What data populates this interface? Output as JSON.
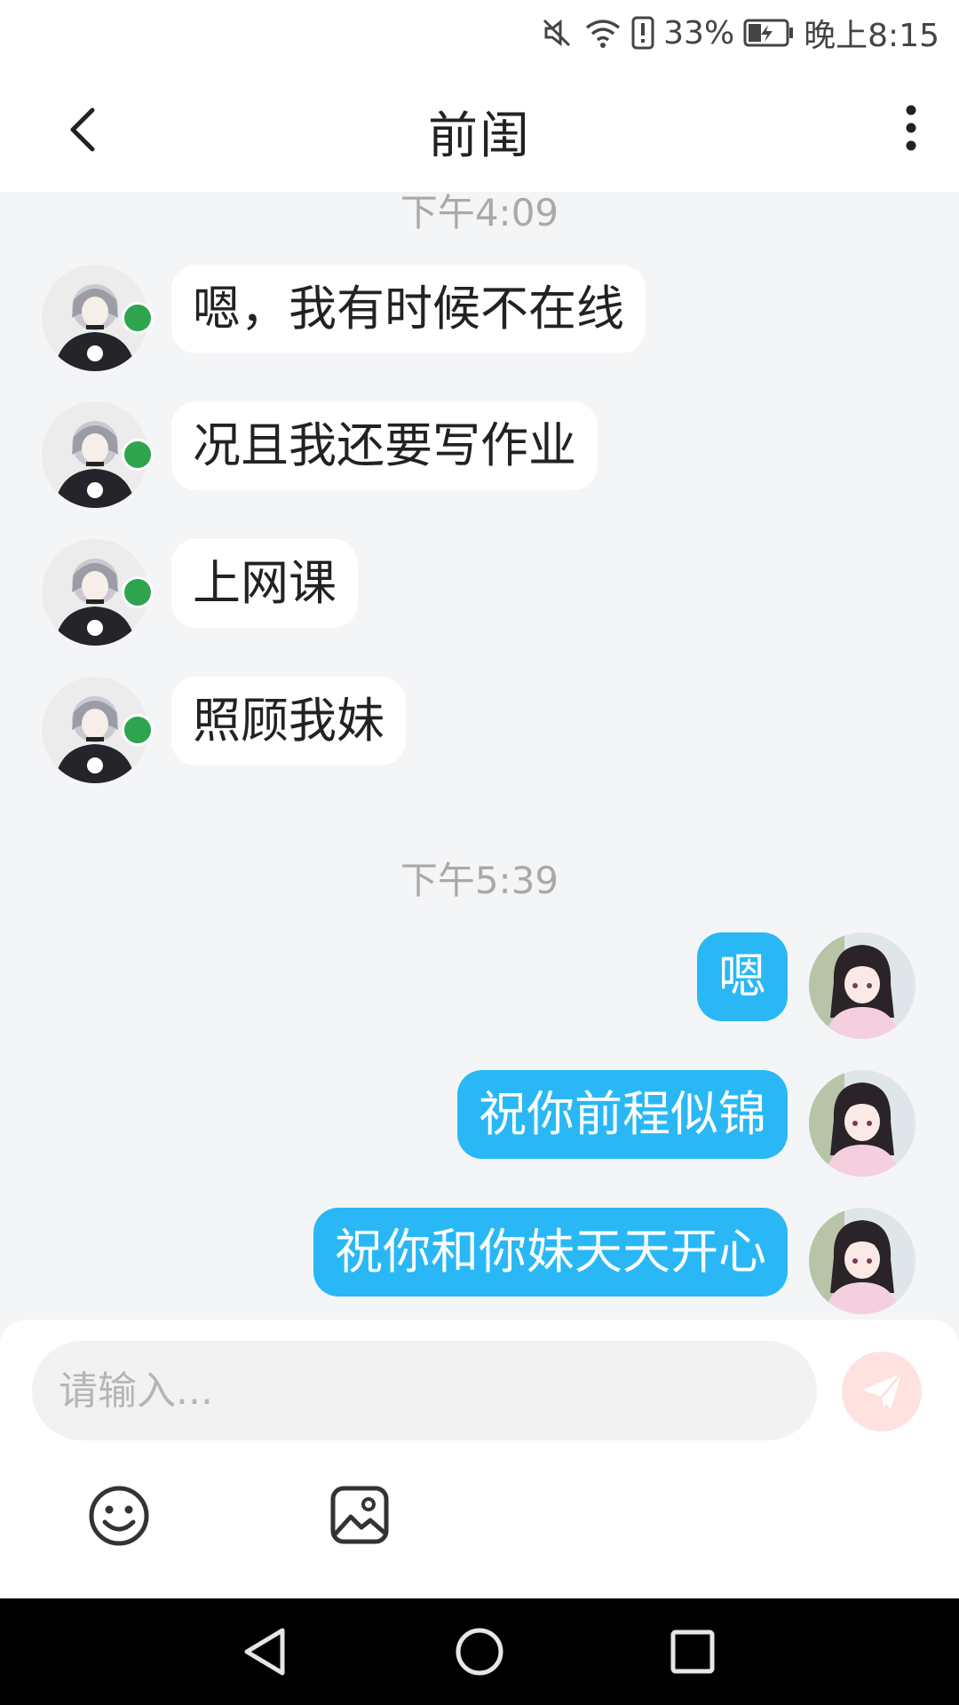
{
  "status_bar": {
    "battery": "33%",
    "time": "晚上8:15"
  },
  "header": {
    "title": "前闺"
  },
  "chat": {
    "timestamps": [
      "下午4:09",
      "下午5:39"
    ],
    "incoming": [
      "嗯，我有时候不在线",
      "况且我还要写作业",
      "上网课",
      "照顾我妹"
    ],
    "outgoing": [
      "嗯",
      "祝你前程似锦",
      "祝你和你妹天天开心"
    ]
  },
  "input": {
    "placeholder": "请输入..."
  },
  "colors": {
    "outgoing_bubble": "#29b8f5",
    "send_button": "#fde2e0",
    "send_icon": "#ffffff",
    "online": "#2ea44f"
  },
  "icons": [
    "back-arrow-icon",
    "more-vertical-icon",
    "emoji-icon",
    "image-icon",
    "send-icon",
    "nav-back-icon",
    "nav-home-icon",
    "nav-recents-icon"
  ]
}
